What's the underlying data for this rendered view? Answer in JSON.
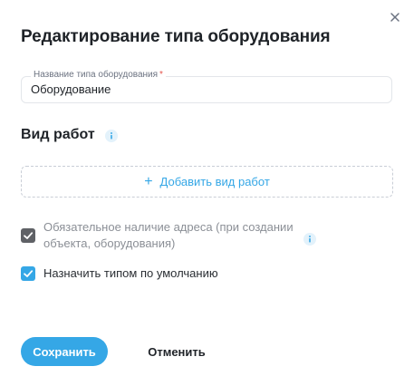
{
  "dialog": {
    "title": "Редактирование типа оборудования",
    "close_icon": "close-icon"
  },
  "field": {
    "label": "Название типа оборудования",
    "required_mark": "*",
    "value": "Оборудование",
    "placeholder": ""
  },
  "work_section": {
    "title": "Вид работ",
    "info_icon": "info-icon",
    "add_button": {
      "icon": "plus-icon",
      "label": "Добавить вид работ"
    }
  },
  "options": {
    "address_required": {
      "label": "Обязательное наличие адреса (при создании объекта, оборудования)",
      "checked": true,
      "disabled": true,
      "info_icon": "info-icon"
    },
    "default_type": {
      "label": "Назначить типом по умолчанию",
      "checked": true,
      "disabled": false
    }
  },
  "actions": {
    "save_label": "Сохранить",
    "cancel_label": "Отменить"
  },
  "colors": {
    "accent": "#35a7e6",
    "text": "#1f2328",
    "muted_text": "#8b8f96",
    "disabled_checkbox": "#5f6166",
    "required": "#e5534b",
    "border": "#e3e6ea"
  }
}
